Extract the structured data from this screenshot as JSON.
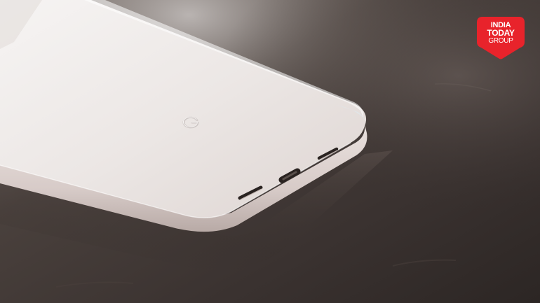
{
  "logo": {
    "line1": "INDIA",
    "line2": "TODAY",
    "line3": "GROUP",
    "color": "#e8232b"
  },
  "photo": {
    "subject_icon": "google-g-logo-icon",
    "surface_color": "#3a3330",
    "device_color": "#ece7e4"
  }
}
